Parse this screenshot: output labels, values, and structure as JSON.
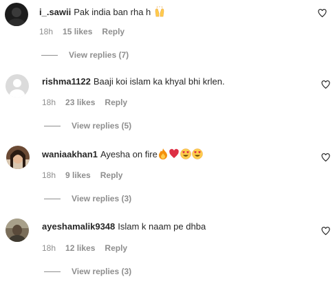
{
  "comments": [
    {
      "username": "i_.sawii",
      "text": "Pak india ban rha h",
      "emoji": [
        "raised-hands-emoji"
      ],
      "time": "18h",
      "likes": "15 likes",
      "reply": "Reply",
      "view_replies": "View replies (7)",
      "avatar": "dark-profile-photo"
    },
    {
      "username": "rishma1122",
      "text": "Baaji koi islam ka khyal bhi krlen.",
      "emoji": [],
      "time": "18h",
      "likes": "23 likes",
      "reply": "Reply",
      "view_replies": "View replies (5)",
      "avatar": "default-profile-placeholder"
    },
    {
      "username": "waniaakhan1",
      "text": "Ayesha on fire",
      "emoji": [
        "fire-emoji",
        "red-heart-emoji",
        "heart-eyes-emoji",
        "heart-eyes-emoji"
      ],
      "time": "18h",
      "likes": "9 likes",
      "reply": "Reply",
      "view_replies": "View replies (3)",
      "avatar": "woman-profile-photo"
    },
    {
      "username": "ayeshamalik9348",
      "text": "Islam k naam pe dhba",
      "emoji": [],
      "time": "18h",
      "likes": "12 likes",
      "reply": "Reply",
      "view_replies": "View replies (3)",
      "avatar": "outdoor-profile-photo"
    }
  ],
  "colors": {
    "text": "#262626",
    "secondary": "#8e8e8e",
    "heart_red": "#e0245e",
    "fire_orange": "#f4900c"
  }
}
